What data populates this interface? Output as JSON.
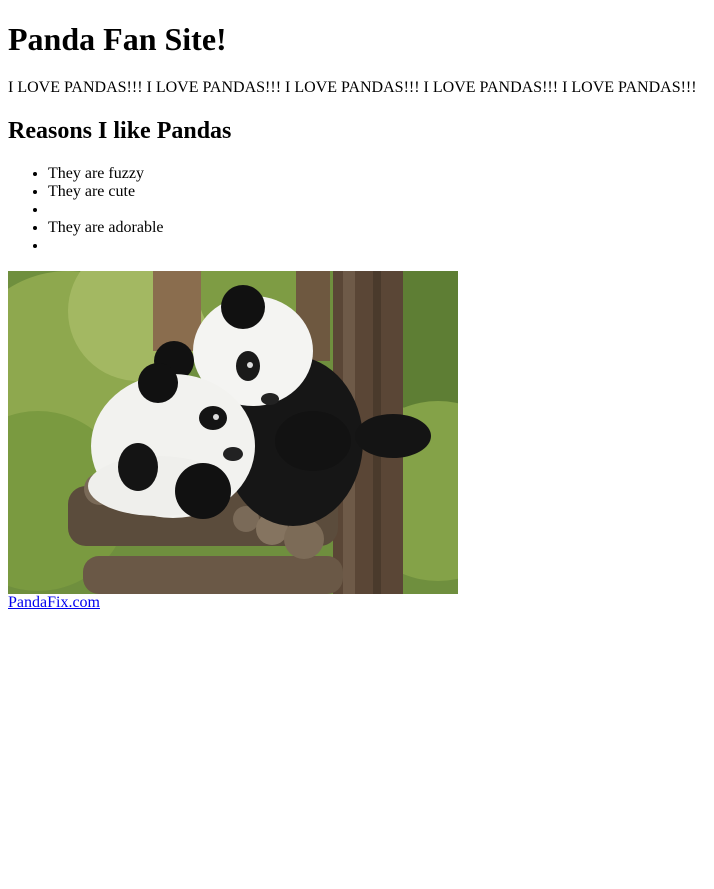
{
  "page": {
    "title": "Panda Fan Site!",
    "love_text": "I LOVE PANDAS!!! I LOVE PANDAS!!! I LOVE PANDAS!!! I LOVE PANDAS!!! I LOVE PANDAS!!!",
    "reasons_heading": "Reasons I like Pandas",
    "reasons": [
      "They are fuzzy",
      "They are cute",
      "",
      "They are adorable",
      ""
    ],
    "photo": {
      "subject": "two giant pandas hugging on a wooden log platform in a tree",
      "icon": "panda-photo"
    },
    "link_text": "PandaFix.com"
  },
  "colors": {
    "link": "#0000ee",
    "text": "#000000",
    "background": "#ffffff"
  }
}
